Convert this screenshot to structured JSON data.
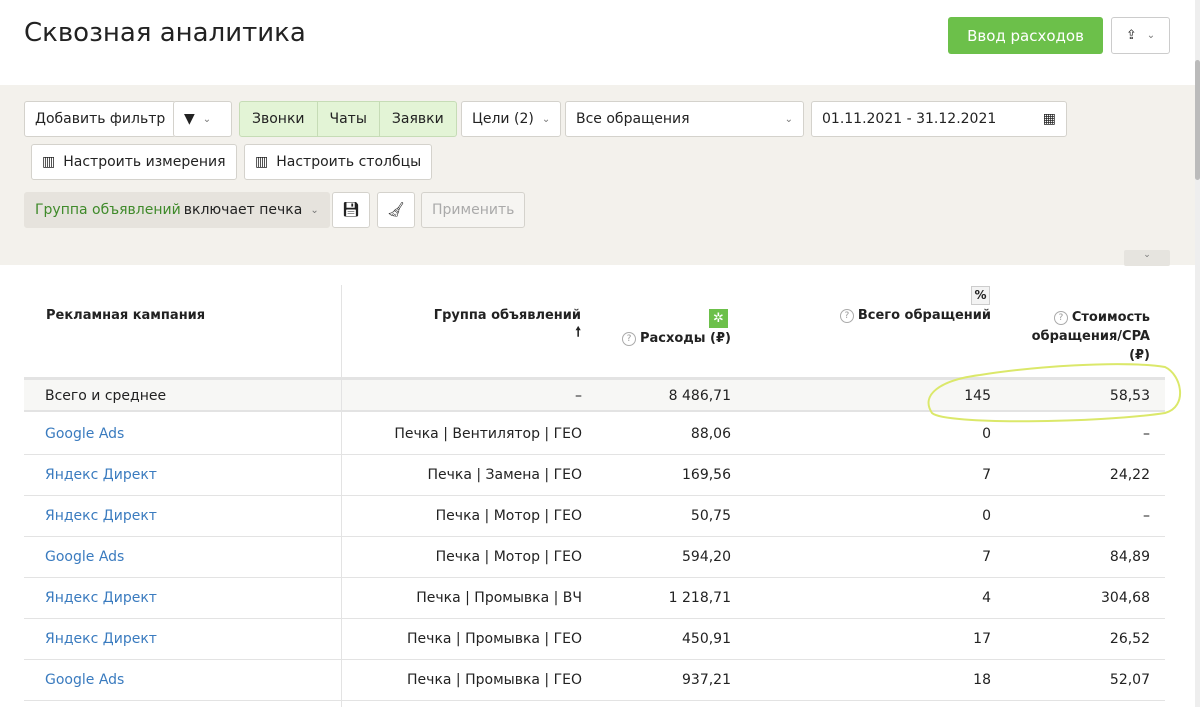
{
  "header": {
    "title": "Сквозная аналитика",
    "expense_button": "Ввод расходов"
  },
  "toolbar": {
    "add_filter": "Добавить фильтр",
    "types": [
      "Звонки",
      "Чаты",
      "Заявки"
    ],
    "goals": "Цели (2)",
    "requests_select": "Все обращения",
    "date_range": "01.11.2021 - 31.12.2021",
    "dimensions": "Настроить измерения",
    "columns": "Настроить столбцы",
    "filter_field": "Группа объявлений",
    "filter_rest": "включает печка",
    "apply": "Применить"
  },
  "table": {
    "headers": {
      "campaign": "Рекламная кампания",
      "group": "Группа объявлений",
      "expenses": "Расходы (₽)",
      "total": "Всего обращений",
      "percent": "%",
      "cpa": "Стоимость обращения/CPA (₽)"
    },
    "total_row": {
      "label": "Всего и среднее",
      "group": "–",
      "expenses": "8 486,71",
      "total": "145",
      "cpa": "58,53"
    },
    "rows": [
      {
        "campaign": "Google Ads",
        "group": "Печка | Вентилятор | ГЕО",
        "expenses": "88,06",
        "total": "0",
        "cpa": "–"
      },
      {
        "campaign": "Яндекс Директ",
        "group": "Печка | Замена | ГЕО",
        "expenses": "169,56",
        "total": "7",
        "cpa": "24,22"
      },
      {
        "campaign": "Яндекс Директ",
        "group": "Печка | Мотор | ГЕО",
        "expenses": "50,75",
        "total": "0",
        "cpa": "–"
      },
      {
        "campaign": "Google Ads",
        "group": "Печка | Мотор | ГЕО",
        "expenses": "594,20",
        "total": "7",
        "cpa": "84,89"
      },
      {
        "campaign": "Яндекс Директ",
        "group": "Печка | Промывка | ВЧ",
        "expenses": "1 218,71",
        "total": "4",
        "cpa": "304,68"
      },
      {
        "campaign": "Яндекс Директ",
        "group": "Печка | Промывка | ГЕО",
        "expenses": "450,91",
        "total": "17",
        "cpa": "26,52"
      },
      {
        "campaign": "Google Ads",
        "group": "Печка | Промывка | ГЕО",
        "expenses": "937,21",
        "total": "18",
        "cpa": "52,07"
      }
    ]
  }
}
